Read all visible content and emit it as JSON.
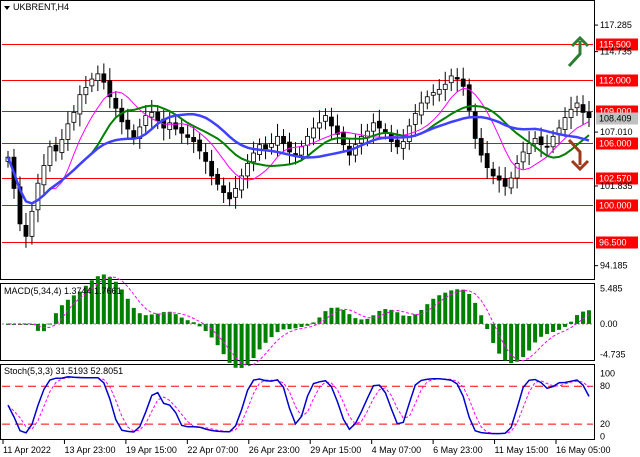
{
  "header": {
    "symbol": "UKBRENT,H4"
  },
  "chart_data": [
    {
      "type": "candlestick",
      "title": "UKBRENT,H4",
      "ylim": [
        93.0,
        119.5
      ],
      "y_ticks": [
        "117.285",
        "114.735",
        "112.000",
        "109.000",
        "108.409",
        "107.010",
        "106.000",
        "102.570",
        "101.835",
        "100.000",
        "96.500",
        "94.185"
      ],
      "levels": [
        115.5,
        112.0,
        109.0,
        106.0,
        102.57,
        100.0,
        96.5
      ],
      "level_labels": [
        "115.500",
        "112.000",
        "109.000",
        "106.000",
        "102.570",
        "100.000",
        "96.500"
      ],
      "current_price": 108.409,
      "current_price_label": "108.409",
      "x_ticks": [
        "11 Apr 2022",
        "13 Apr 23:00",
        "19 Apr 15:00",
        "22 Apr 07:00",
        "26 Apr 23:00",
        "29 Apr 15:00",
        "4 May 07:00",
        "6 May 23:00",
        "11 May 15:00",
        "16 May 05:00"
      ],
      "close": [
        104.6,
        101.6,
        98.2,
        97.0,
        99.4,
        102.1,
        103.8,
        105.6,
        105.2,
        106.3,
        107.8,
        108.9,
        110.6,
        111.3,
        112.1,
        112.6,
        111.8,
        110.4,
        109.3,
        108.0,
        107.3,
        106.4,
        107.5,
        108.6,
        108.9,
        108.1,
        107.4,
        107.9,
        107.3,
        106.9,
        106.5,
        106.1,
        105.2,
        104.2,
        102.8,
        102.0,
        101.2,
        100.6,
        101.6,
        102.8,
        104.0,
        105.0,
        105.8,
        105.4,
        105.9,
        106.6,
        105.9,
        105.1,
        104.8,
        105.6,
        106.6,
        107.4,
        107.9,
        108.6,
        107.6,
        106.8,
        105.8,
        104.8,
        105.8,
        106.6,
        107.1,
        107.9,
        107.4,
        106.9,
        106.1,
        105.6,
        106.1,
        107.6,
        108.8,
        109.8,
        110.4,
        110.8,
        111.1,
        111.6,
        112.4,
        112.1,
        111.4,
        109.1,
        106.4,
        104.8,
        103.6,
        102.8,
        102.4,
        101.8,
        102.6,
        104.0,
        105.1,
        105.9,
        106.4,
        105.8,
        105.6,
        106.6,
        107.4,
        108.4,
        109.2,
        109.8,
        108.9,
        108.4
      ],
      "indicators": [
        "SMA fast (green)",
        "SMA (blue)",
        "SMA (magenta)"
      ]
    },
    {
      "type": "bar",
      "title": "MACD(5,34,4) 1.3744 1.7661",
      "ylim": [
        -5.4,
        6.0
      ],
      "y_ticks": [
        "5.485",
        "0.00",
        "-4.735"
      ]
    },
    {
      "type": "line",
      "title": "Stoch(5,3,3) 31.5193 52.8051",
      "ylim": [
        -2,
        112
      ],
      "y_ticks": [
        "100",
        "80",
        "20",
        "0"
      ],
      "levels": [
        80,
        20
      ]
    }
  ],
  "colors": {
    "level": "#ff0000",
    "label_bg": "#ff0000",
    "current_price_bg": "#c0c0c0",
    "bar_green": "#008000",
    "up_arrow": "#2e7d32",
    "down_arrow": "#a0391c",
    "stoch_main": "#0000cc",
    "stoch_signal": "#ff00ff",
    "ma_green": "#008000",
    "ma_blue": "#4040ff",
    "ma_magenta": "#ff00ff"
  },
  "icons": [
    "up-arrow-icon",
    "down-arrow-icon",
    "dropdown-triangle-icon"
  ]
}
